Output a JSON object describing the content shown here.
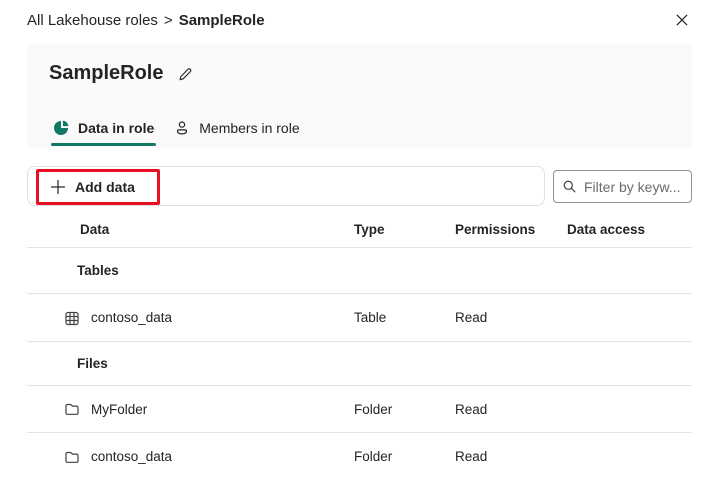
{
  "breadcrumb": {
    "parent": "All Lakehouse roles",
    "separator": ">",
    "current": "SampleRole"
  },
  "header": {
    "title": "SampleRole"
  },
  "tabs": {
    "data_in_role": {
      "label": "Data in role",
      "icon": "pie-chart-icon",
      "active": true
    },
    "members_in_role": {
      "label": "Members in role",
      "icon": "person-icon",
      "active": false
    }
  },
  "toolbar": {
    "add_data_label": "Add data",
    "filter_placeholder": "Filter by keyw..."
  },
  "table": {
    "columns": {
      "data": "Data",
      "type": "Type",
      "permissions": "Permissions",
      "data_access": "Data access"
    },
    "rows": [
      {
        "kind": "group",
        "label": "Tables"
      },
      {
        "kind": "item",
        "icon": "table-grid-icon",
        "name": "contoso_data",
        "type": "Table",
        "permissions": "Read",
        "data_access": ""
      },
      {
        "kind": "group",
        "label": "Files"
      },
      {
        "kind": "item",
        "icon": "folder-icon",
        "name": "MyFolder",
        "type": "Folder",
        "permissions": "Read",
        "data_access": ""
      },
      {
        "kind": "item",
        "icon": "folder-icon",
        "name": "contoso_data",
        "type": "Folder",
        "permissions": "Read",
        "data_access": ""
      }
    ]
  },
  "colors": {
    "accent_teal": "#117865",
    "annotation_red": "#e81123"
  }
}
